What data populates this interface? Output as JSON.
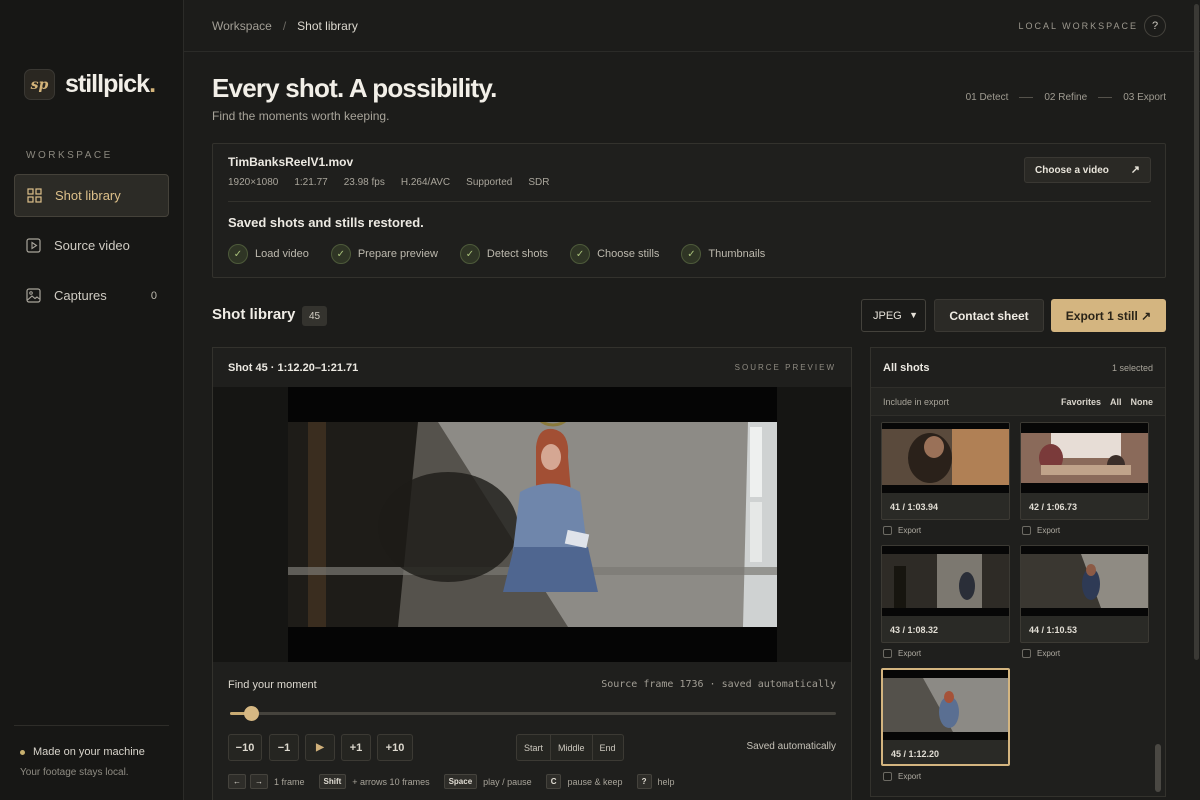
{
  "app": {
    "name": "stillpick",
    "logo_mark": "sp"
  },
  "sidebar": {
    "section": "WORKSPACE",
    "items": [
      {
        "label": "Shot library",
        "icon": "grid-icon",
        "active": true
      },
      {
        "label": "Source video",
        "icon": "play-square-icon"
      },
      {
        "label": "Captures",
        "icon": "image-icon",
        "count": "0"
      }
    ],
    "footer_title": "Made on your machine",
    "footer_sub": "Your footage stays local."
  },
  "topbar": {
    "breadcrumb": [
      "Workspace",
      "Shot library"
    ],
    "workspace_label": "LOCAL WORKSPACE",
    "help": "?"
  },
  "header": {
    "title": "Every shot. A possibility.",
    "subtitle": "Find the moments worth keeping.",
    "steps": [
      "01  Detect",
      "02  Refine",
      "03  Export"
    ]
  },
  "video": {
    "filename": "TimBanksReelV1.mov",
    "meta": [
      "1920×1080",
      "1:21.77",
      "23.98 fps",
      "H.264/AVC",
      "Supported",
      "SDR"
    ],
    "choose_label": "Choose a video",
    "choose_arrow": "↗",
    "restored": "Saved shots and stills restored.",
    "checks": [
      "Load video",
      "Prepare preview",
      "Detect shots",
      "Choose stills",
      "Thumbnails"
    ],
    "check_mark": "✓"
  },
  "library": {
    "title": "Shot library",
    "count": "45",
    "format": "JPEG",
    "contact_label": "Contact sheet",
    "export_label": "Export 1 still ↗"
  },
  "preview": {
    "title": "Shot 45 · 1:12.20–1:21.71",
    "source_label": "SOURCE PREVIEW",
    "find_label": "Find your moment",
    "frame_info": "Source frame 1736 · saved automatically",
    "slider_fraction": 0.035,
    "controls": [
      "−10",
      "−1",
      "▶",
      "+1",
      "+10"
    ],
    "segments": [
      "Start",
      "Middle",
      "End"
    ],
    "saved": "Saved automatically",
    "hints": [
      {
        "keys": [
          "←",
          "→"
        ],
        "text": "1 frame"
      },
      {
        "keys": [
          "Shift"
        ],
        "text": "+ arrows 10 frames"
      },
      {
        "keys": [
          "Space"
        ],
        "text": "play / pause"
      },
      {
        "keys": [
          "C"
        ],
        "text": "pause & keep"
      },
      {
        "keys": [
          "?"
        ],
        "text": "help"
      }
    ]
  },
  "shots": {
    "title": "All shots",
    "selected": "1 selected",
    "include_label": "Include in export",
    "links": [
      "Favorites",
      "All",
      "None"
    ],
    "export_label": "Export",
    "tiles": [
      {
        "label": "41 / 1:03.94",
        "selected": false
      },
      {
        "label": "42 / 1:06.73",
        "selected": false
      },
      {
        "label": "43 / 1:08.32",
        "selected": false
      },
      {
        "label": "44 / 1:10.53",
        "selected": false
      },
      {
        "label": "45 / 1:12.20",
        "selected": true
      }
    ]
  },
  "colors": {
    "accent": "#d4b580",
    "background": "#1c1c1a",
    "success": "#a8c07a"
  }
}
